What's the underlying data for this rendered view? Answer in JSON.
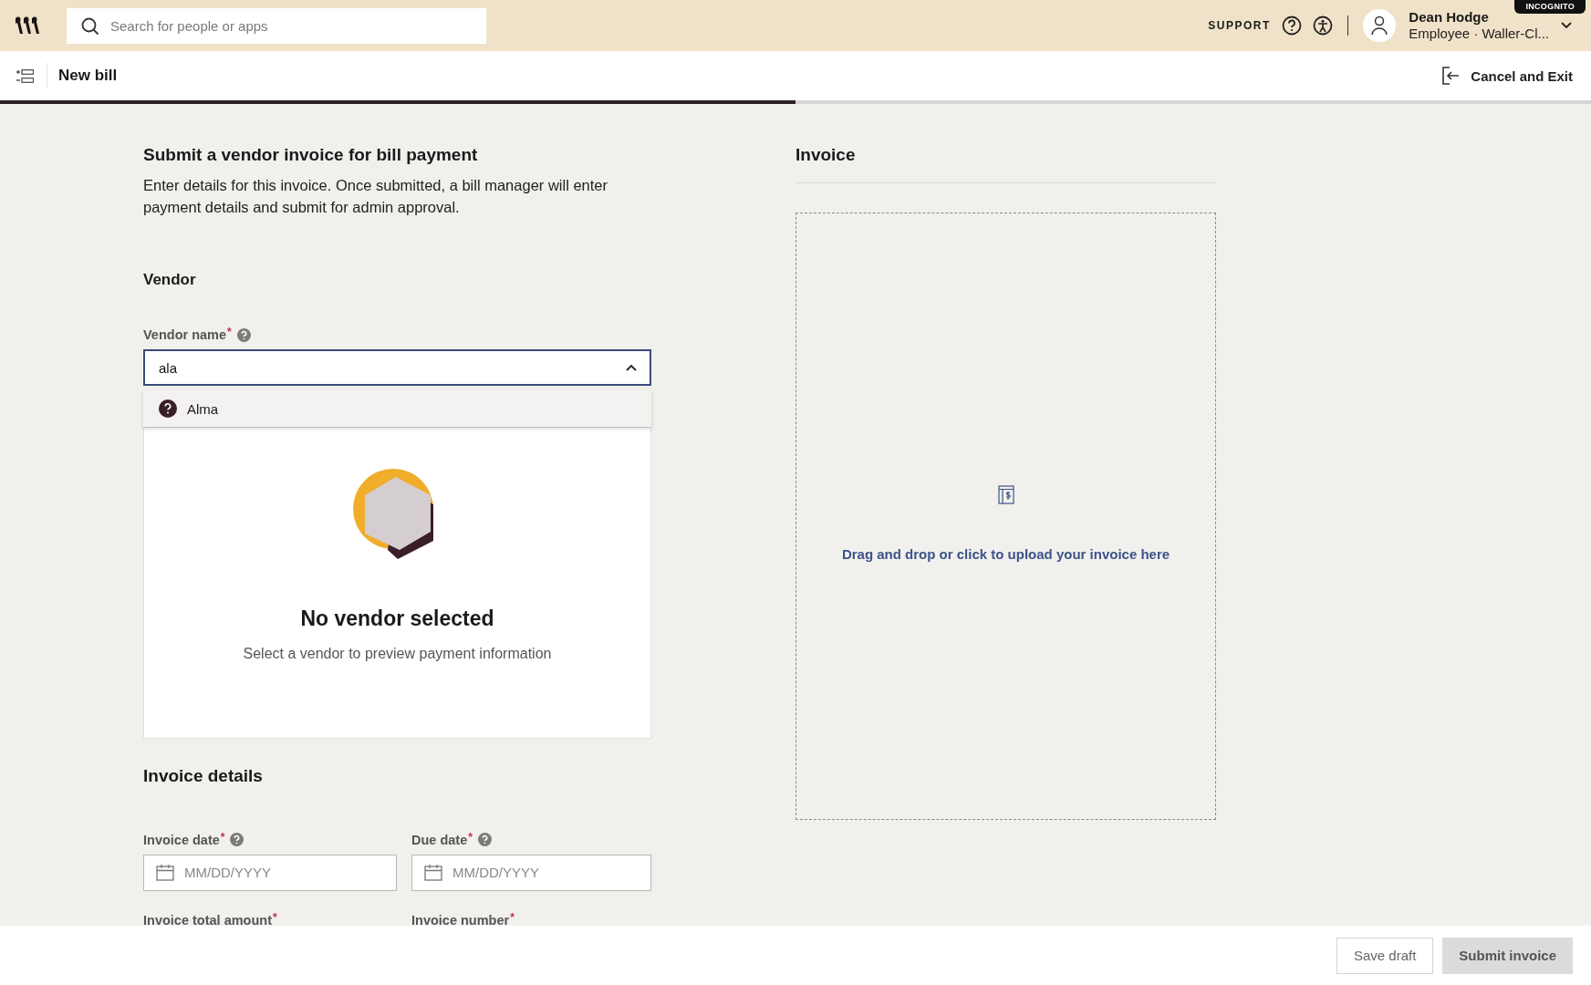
{
  "topbar": {
    "search": {
      "placeholder": "Search for people or apps"
    },
    "support": "SUPPORT",
    "badge": "INCOGNITO",
    "user": {
      "name": "Dean Hodge",
      "subtitle": "Employee · Waller-Cl..."
    }
  },
  "header": {
    "title": "New bill",
    "exit": "Cancel and Exit",
    "progress": {
      "level": 0.5
    }
  },
  "form": {
    "title": "Submit a vendor invoice for bill payment",
    "description": "Enter details for this invoice. Once submitted, a bill manager will enter payment details and submit for admin approval.",
    "vendor_section": {
      "heading": "Vendor",
      "field": {
        "label": "Vendor name",
        "required_mark": "*",
        "help": true,
        "value": "ala",
        "expanded": true
      },
      "options": [
        {
          "label": "Alma"
        }
      ],
      "empty_state": {
        "title": "No vendor selected",
        "text": "Select a vendor to preview payment information"
      }
    },
    "invoice_section": {
      "heading": "Invoice details",
      "fields": [
        {
          "label": "Invoice date",
          "required_mark": "*",
          "help": true,
          "kind": "date",
          "placeholder": "MM/DD/YYYY"
        },
        {
          "label": "Due date",
          "required_mark": "*",
          "help": true,
          "kind": "date",
          "placeholder": "MM/DD/YYYY"
        },
        {
          "label": "Invoice total amount",
          "required_mark": "*",
          "kind": "hidden"
        },
        {
          "label": "Invoice number",
          "required_mark": "*",
          "kind": "hidden"
        }
      ]
    }
  },
  "invoice_panel": {
    "heading": "Invoice",
    "upload_text": "Drag and drop or click to upload your invoice here"
  },
  "footer": {
    "buttons": [
      {
        "label": "Save draft",
        "disabled": false
      },
      {
        "label": "Submit invoice",
        "disabled": true
      }
    ]
  }
}
